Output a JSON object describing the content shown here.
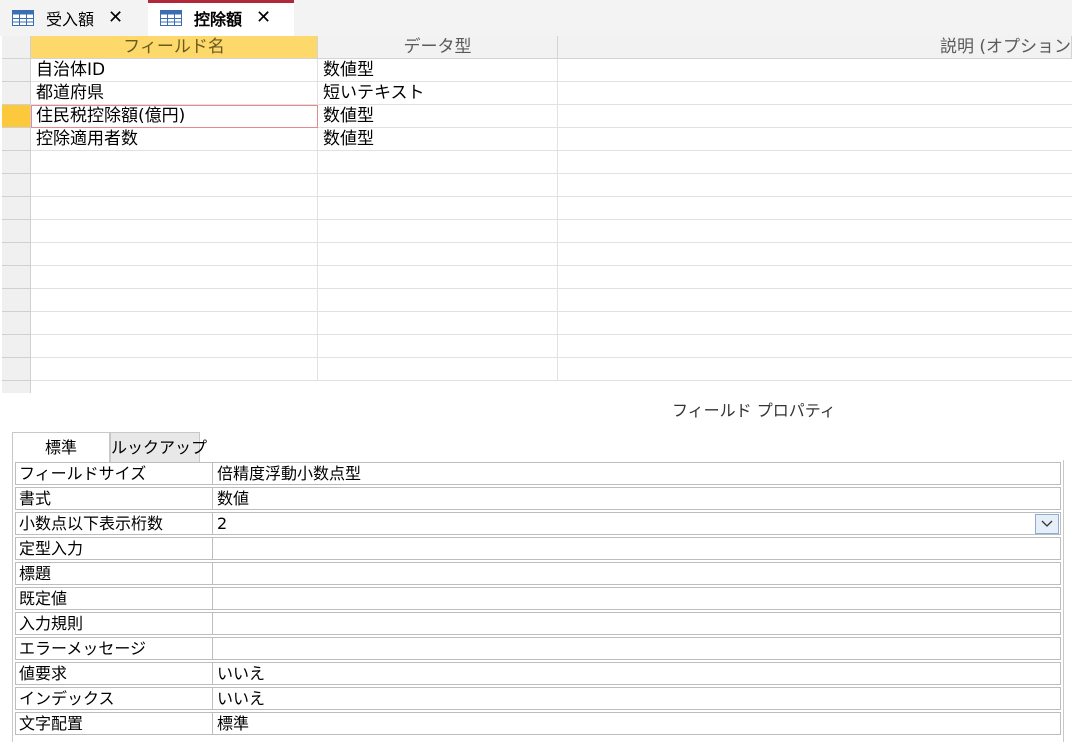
{
  "tabs": [
    {
      "label": "受入額",
      "icon": "table-icon",
      "close_icon": "close-icon",
      "active": false
    },
    {
      "label": "控除額",
      "icon": "table-icon",
      "close_icon": "close-icon",
      "active": true
    }
  ],
  "colors": {
    "accent_tab": "#b2273a",
    "selected_header": "#fdd86a",
    "current_row_selector": "#fbc93b"
  },
  "grid": {
    "headers": {
      "name": "フィールド名",
      "type": "データ型",
      "description": "説明 (オプション"
    },
    "rows": [
      {
        "name": "自治体ID",
        "type": "数値型",
        "description": ""
      },
      {
        "name": "都道府県",
        "type": "短いテキスト",
        "description": ""
      },
      {
        "name": "住民税控除額(億円)",
        "type": "数値型",
        "description": ""
      },
      {
        "name": "控除適用者数",
        "type": "数値型",
        "description": ""
      }
    ],
    "current_row": 2
  },
  "properties": {
    "title": "フィールド プロパティ",
    "tabs": [
      "標準",
      "ルックアップ"
    ],
    "rows": [
      {
        "label": "フィールドサイズ",
        "value": "倍精度浮動小数点型"
      },
      {
        "label": "書式",
        "value": "数値"
      },
      {
        "label": "小数点以下表示桁数",
        "value": "2"
      },
      {
        "label": "定型入力",
        "value": ""
      },
      {
        "label": "標題",
        "value": ""
      },
      {
        "label": "既定値",
        "value": ""
      },
      {
        "label": "入力規則",
        "value": ""
      },
      {
        "label": "エラーメッセージ",
        "value": ""
      },
      {
        "label": "値要求",
        "value": "いいえ"
      },
      {
        "label": "インデックス",
        "value": "いいえ"
      },
      {
        "label": "文字配置",
        "value": "標準"
      }
    ],
    "dropdown_row": 2,
    "dropdown_icon": "chevron-down-icon"
  }
}
